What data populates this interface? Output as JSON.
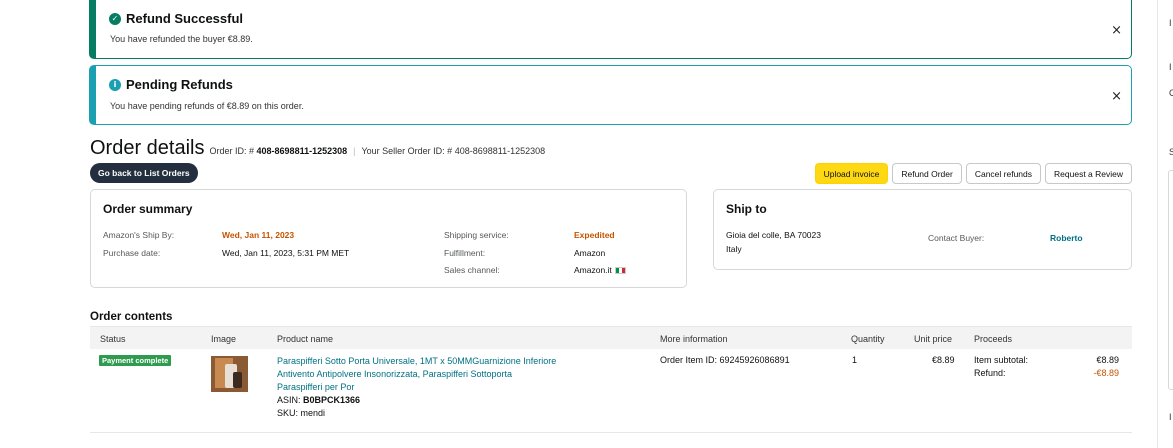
{
  "alerts": {
    "success": {
      "title": "Refund Successful",
      "message": "You have refunded the buyer €8.89.",
      "close": "×"
    },
    "info": {
      "title": "Pending Refunds",
      "message": "You have pending refunds of €8.89 on this order.",
      "close": "×"
    }
  },
  "order": {
    "title": "Order details",
    "order_id_label": "Order ID: #",
    "order_id": "408-8698811-1252308",
    "seller_order_id_label": "Your Seller Order ID: #",
    "seller_order_id": "408-8698811-1252308",
    "back_button": "Go back to List Orders",
    "actions": {
      "upload_invoice": "Upload invoice",
      "refund_order": "Refund Order",
      "cancel_refunds": "Cancel refunds",
      "request_review": "Request a Review"
    }
  },
  "summary": {
    "title": "Order summary",
    "ship_by_label": "Amazon's Ship By:",
    "ship_by": "Wed, Jan 11, 2023",
    "purchase_date_label": "Purchase date:",
    "purchase_date": "Wed, Jan 11, 2023, 5:31 PM MET",
    "shipping_service_label": "Shipping service:",
    "shipping_service": "Expedited",
    "fulfillment_label": "Fulfillment:",
    "fulfillment": "Amazon",
    "sales_channel_label": "Sales channel:",
    "sales_channel": "Amazon.it"
  },
  "ship_to": {
    "title": "Ship to",
    "address_line1": "Gioia del colle, BA 70023",
    "address_line2": "Italy",
    "contact_label": "Contact Buyer:",
    "contact_name": "Roberto"
  },
  "contents": {
    "title": "Order contents",
    "headers": {
      "status": "Status",
      "image": "Image",
      "product": "Product name",
      "more_info": "More information",
      "quantity": "Quantity",
      "unit_price": "Unit price",
      "proceeds": "Proceeds"
    },
    "row": {
      "status": "Payment complete",
      "product_name_line1": "Paraspifferi Sotto Porta Universale, 1MT x 50MMGuarnizione Inferiore",
      "product_name_line2": "Antivento Antipolvere Insonorizzata, Paraspifferi Sottoporta",
      "product_name_line3": "Paraspifferi per Por",
      "asin_label": "ASIN:",
      "asin": "B0BPCK1366",
      "sku_label": "SKU:",
      "sku": "mendi",
      "more_info": "Order Item ID: 69245926086891",
      "quantity": "1",
      "unit_price": "€8.89",
      "subtotal_label": "Item subtotal:",
      "subtotal": "€8.89",
      "refund_label": "Refund:",
      "refund": "-€8.89"
    }
  },
  "edge_chars": [
    "I",
    "I",
    "C",
    "S",
    "I"
  ]
}
